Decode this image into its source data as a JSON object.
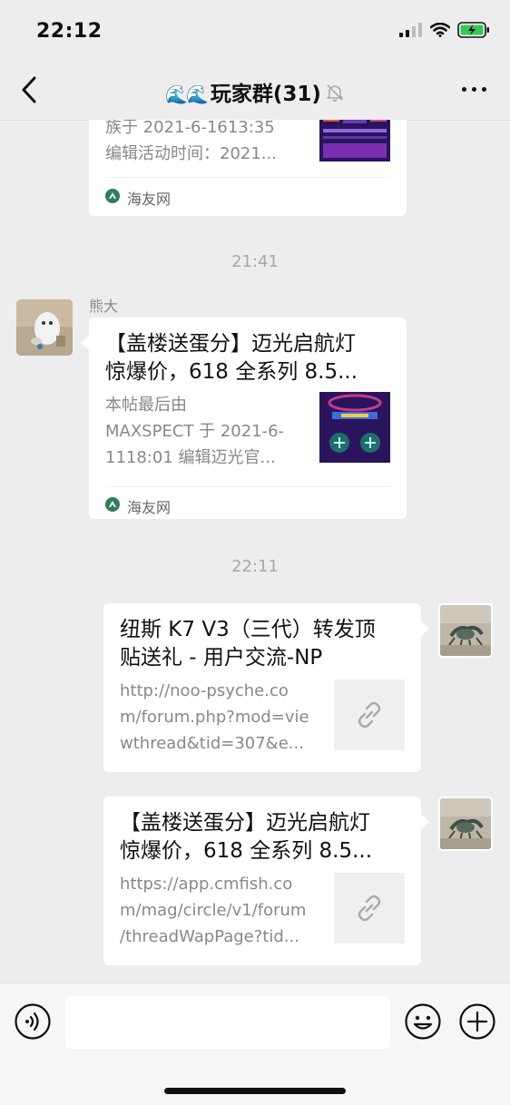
{
  "status_bar": {
    "time": "22:12"
  },
  "nav": {
    "title": "玩家群(31)",
    "title_emoji": "🌊🌊",
    "back_icon": "chevron-left-icon",
    "more_icon": "more-dots-icon",
    "mute_icon": "bell-slash-icon"
  },
  "messages": [
    {
      "type": "link-card-partial",
      "side": "left",
      "desc_line1": "族于 2021-6-1613:35",
      "desc_line2": "编辑活动时间：2021...",
      "source": "海友网"
    },
    {
      "type": "time",
      "text": "21:41"
    },
    {
      "type": "link-card",
      "side": "left",
      "sender": "熊大",
      "title_line1": "【盖楼送蛋分】迈光启航灯",
      "title_line2": "惊爆价，618 全系列 8.5...",
      "desc_line1": "本帖最后由",
      "desc_line2": "MAXSPECT 于 2021-6-",
      "desc_line3": "1118:01 编辑迈光官...",
      "source": "海友网"
    },
    {
      "type": "time",
      "text": "22:11"
    },
    {
      "type": "link-card",
      "side": "right",
      "title_line1": "纽斯 K7 V3（三代）转发顶",
      "title_line2": "贴送礼 - 用户交流-NP",
      "desc_line1": "http://noo-psyche.co",
      "desc_line2": "m/forum.php?mod=vie",
      "desc_line3": "wthread&tid=307&e..."
    },
    {
      "type": "link-card",
      "side": "right",
      "title_line1": "【盖楼送蛋分】迈光启航灯",
      "title_line2": "惊爆价，618 全系列 8.5...",
      "desc_line1": "https://app.cmfish.co",
      "desc_line2": "m/mag/circle/v1/forum",
      "desc_line3": "/threadWapPage?tid..."
    }
  ],
  "input_bar": {
    "voice_icon": "voice-icon",
    "emoji_icon": "emoji-icon",
    "plus_icon": "plus-circle-icon",
    "placeholder": ""
  },
  "colors": {
    "background": "#ededed",
    "card": "#ffffff",
    "muted_text": "#888888",
    "source_logo": "#2e7d5b"
  }
}
